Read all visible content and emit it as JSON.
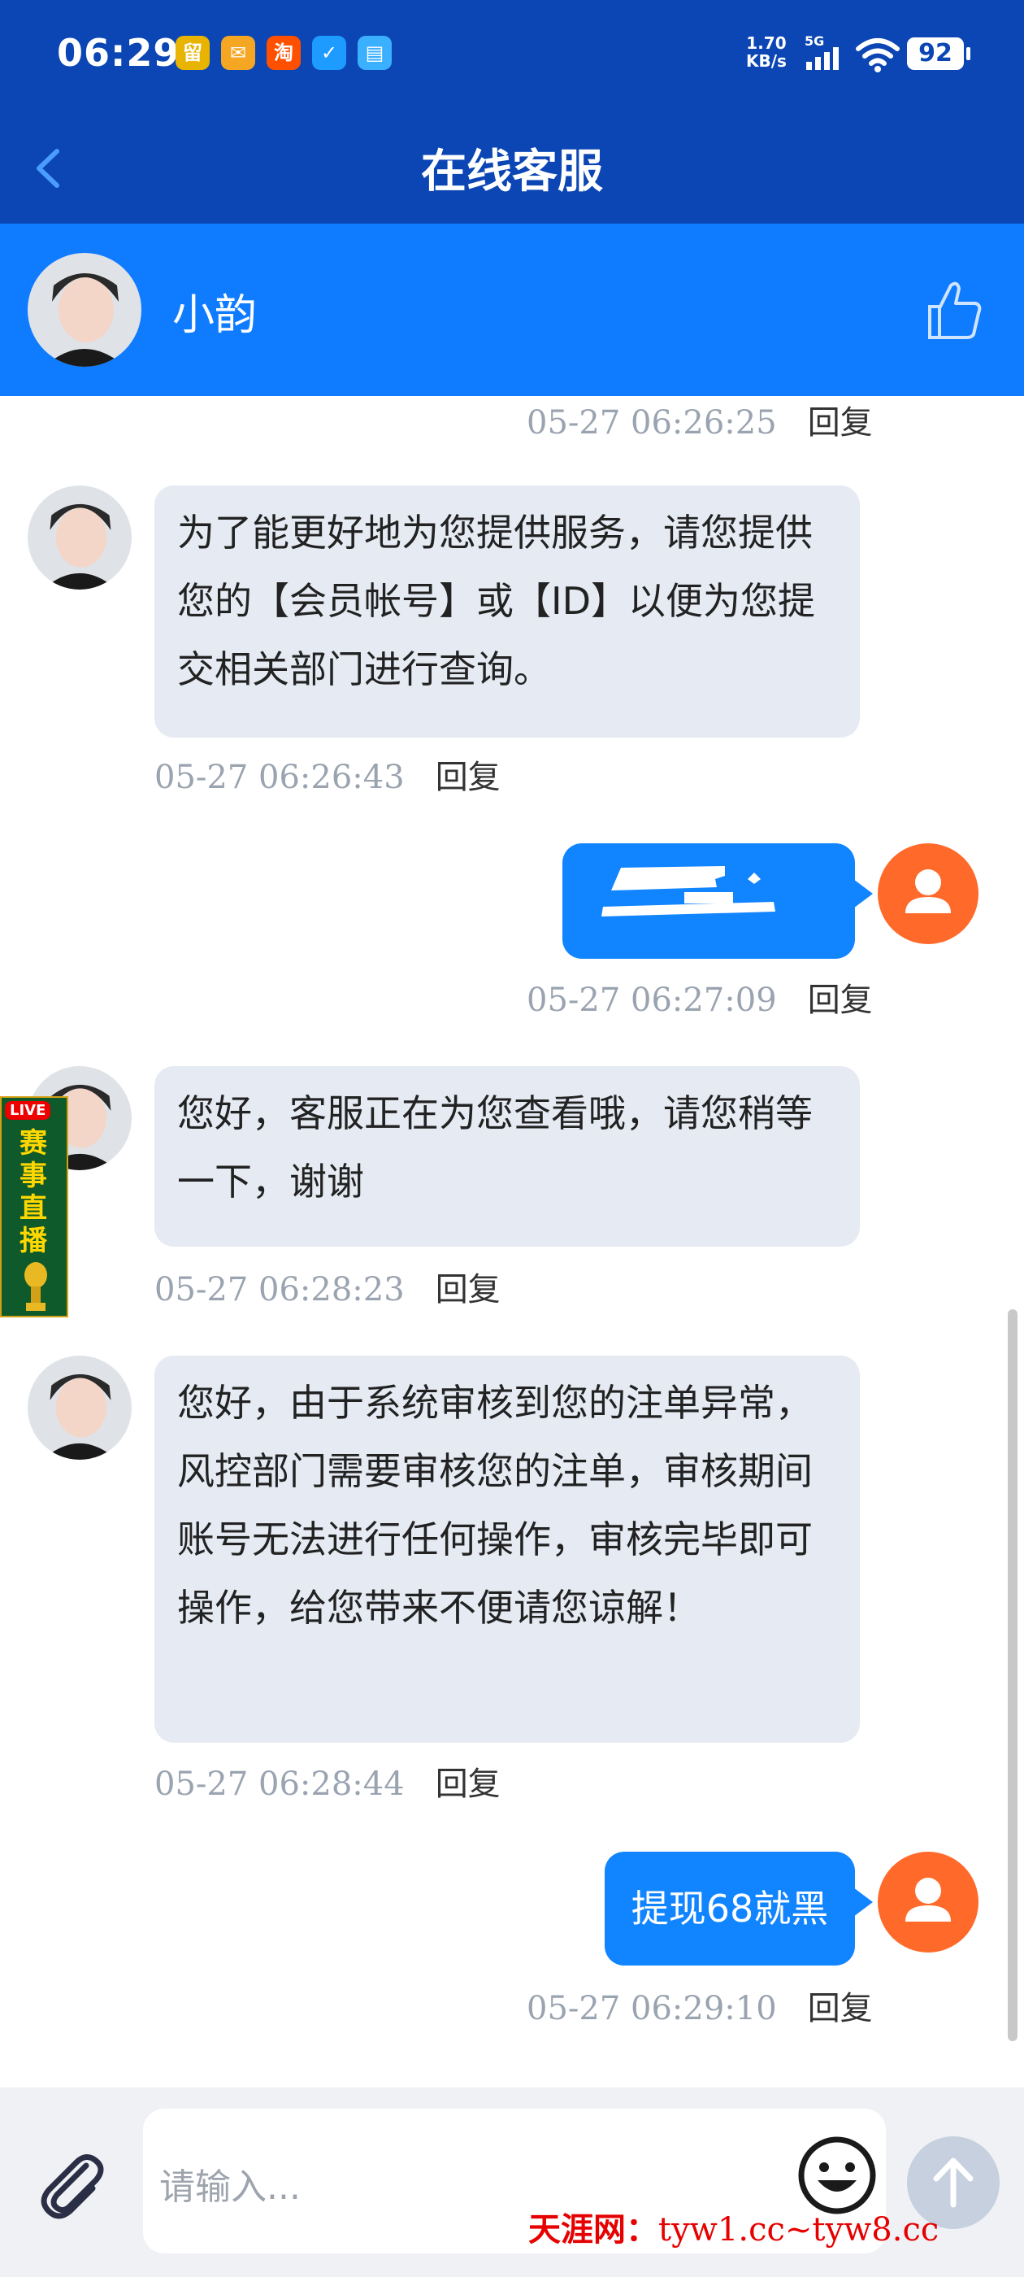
{
  "status_bar": {
    "time": "06:29",
    "net_speed_value": "1.70",
    "net_speed_unit": "KB/s",
    "network": "5G",
    "battery": "92"
  },
  "nav": {
    "title": "在线客服"
  },
  "agent": {
    "name": "小韵"
  },
  "messages": {
    "m0": {
      "time": "05-27 06:26:25",
      "reply": "回复"
    },
    "m1": {
      "text": "为了能更好地为您提供服务，请您提供您的【会员帐号】或【ID】以便为您提交相关部门进行查询。",
      "time": "05-27 06:26:43",
      "reply": "回复"
    },
    "m2": {
      "time": "05-27 06:27:09",
      "reply": "回复"
    },
    "m3": {
      "text": "您好，客服正在为您查看哦，请您稍等一下，谢谢",
      "time": "05-27 06:28:23",
      "reply": "回复"
    },
    "m4": {
      "text": "您好，由于系统审核到您的注单异常，风控部门需要审核您的注单，审核期间账号无法进行任何操作，审核完毕即可操作，给您带来不便请您谅解！",
      "time": "05-27 06:28:44",
      "reply": "回复"
    },
    "m5": {
      "text": "提现68就黑",
      "time": "05-27 06:29:10",
      "reply": "回复"
    }
  },
  "live_ad": {
    "tag": "LIVE",
    "text": "赛事直播"
  },
  "input": {
    "placeholder": "请输入..."
  },
  "watermark": {
    "brand": "天涯网：",
    "url": "tyw1.cc~tyw8.cc"
  },
  "icons": [
    "back-arrow-icon",
    "thumbs-up-icon",
    "paperclip-icon",
    "emoji-icon",
    "send-arrow-icon",
    "user-icon",
    "signal-icon",
    "wifi-icon"
  ],
  "colors": {
    "nav_blue": "#0b46b4",
    "header_blue": "#0f7cff",
    "bubble_out": "#1184ff",
    "bubble_in": "#e5eaf3",
    "user_avatar": "#ff6a2b"
  }
}
